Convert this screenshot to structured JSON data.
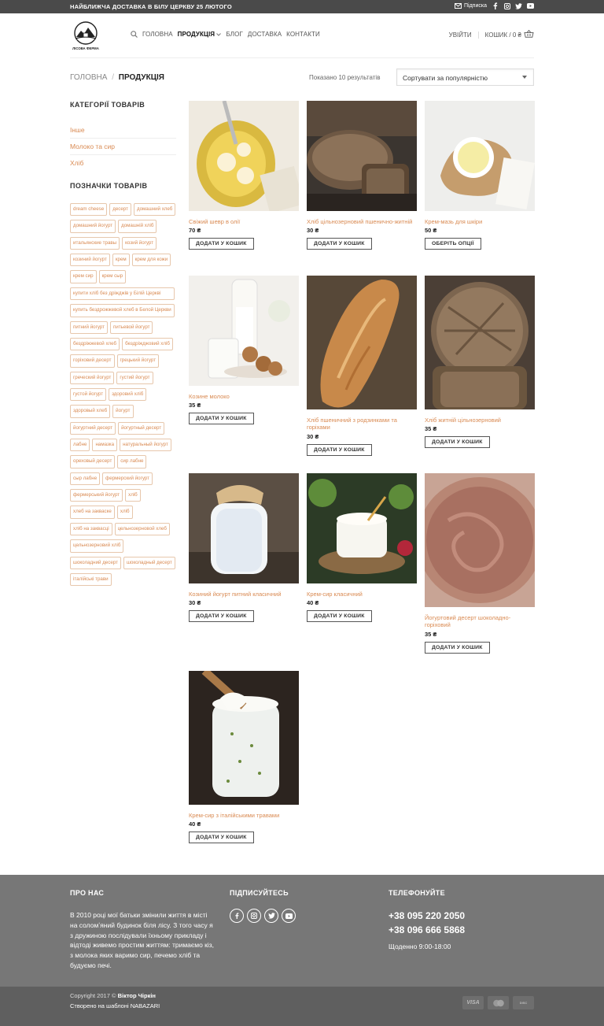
{
  "topbar": {
    "promo": "НАЙБЛИЖЧА ДОСТАВКА В БІЛУ ЦЕРКВУ 25 ЛЮТОГО",
    "subscribe": "Підписка"
  },
  "header": {
    "logo_text": "ЛІСОВА ФЕРМА",
    "nav": [
      {
        "label": "ГОЛОВНА"
      },
      {
        "label": "ПРОДУКЦІЯ"
      },
      {
        "label": "БЛОГ"
      },
      {
        "label": "ДОСТАВКА"
      },
      {
        "label": "КОНТАКТИ"
      }
    ],
    "login": "УВІЙТИ",
    "cart": "КОШИК / 0 ₴"
  },
  "breadcrumb": {
    "home": "ГОЛОВНА",
    "sep": "/",
    "current": "ПРОДУКЦІЯ"
  },
  "results_text": "Показано 10 результатів",
  "sort": {
    "selected": "Сортувати за популярністю"
  },
  "sidebar": {
    "categories_title": "КАТЕГОРІЇ ТОВАРІВ",
    "categories": [
      "Інше",
      "Молоко та сир",
      "Хліб"
    ],
    "tags_title": "ПОЗНАЧКИ ТОВАРІВ",
    "tags": [
      "dream cheese",
      "десерт",
      "домашний хлеб",
      "домашний йогурт",
      "домашній хліб",
      "итальянские травы",
      "козий йогурт",
      "козиний йогурт",
      "крем",
      "крем для кожи",
      "крем сир",
      "крем сыр",
      "купити хліб без дріжджів у Білій Церкві",
      "купить бездрожжевой хлеб в Белой Церкви",
      "питний йогурт",
      "питьевой йогурт",
      "бездріжжевой хлеб",
      "бездріжджовий хліб",
      "горіховий десерт",
      "грецький йогурт",
      "греческий йогурт",
      "густий йогурт",
      "густой йогурт",
      "здоровий хліб",
      "здоровый хлеб",
      "йогурт",
      "йогуртний десерт",
      "йогуртный десерт",
      "лабне",
      "намазка",
      "натуральный йогурт",
      "ореховый десерт",
      "сир лабне",
      "сыр лабне",
      "фермерский йогурт",
      "фермерський йогурт",
      "хліб",
      "хлеб на закваске",
      "хліб",
      "хліб на заквасці",
      "цельнозерновой хлеб",
      "цельнозерновий хліб",
      "шоколадний десерт",
      "шоколадный десерт",
      "італійські трави"
    ]
  },
  "products": [
    {
      "name": "Свіжий шевр в олії",
      "price": "70 ₴",
      "button": "ДОДАТИ У КОШИК"
    },
    {
      "name": "Хліб цільнозерновий пшенично-житній",
      "price": "30 ₴",
      "button": "ДОДАТИ У КОШИК"
    },
    {
      "name": "Крем-мазь для шкіри",
      "price": "50 ₴",
      "button": "ОБЕРІТЬ ОПЦІЇ"
    },
    {
      "name": "Козине молоко",
      "price": "35 ₴",
      "button": "ДОДАТИ У КОШИК"
    },
    {
      "name": "Хліб пшеничний з родзинками та горіхами",
      "price": "30 ₴",
      "button": "ДОДАТИ У КОШИК"
    },
    {
      "name": "Хліб житній цільнозерновий",
      "price": "35 ₴",
      "button": "ДОДАТИ У КОШИК"
    },
    {
      "name": "Козиний йогурт питний класичний",
      "price": "30 ₴",
      "button": "ДОДАТИ У КОШИК"
    },
    {
      "name": "Крем-сир класичний",
      "price": "40 ₴",
      "button": "ДОДАТИ У КОШИК"
    },
    {
      "name": "Йогуртовий десерт шоколадно-горіховий",
      "price": "35 ₴",
      "button": "ДОДАТИ У КОШИК"
    },
    {
      "name": "Крем-сир з італійськими травами",
      "price": "40 ₴",
      "button": "ДОДАТИ У КОШИК"
    }
  ],
  "footer": {
    "about_title": "ПРО НАС",
    "about_text": "В 2010 році мої батьки змінили життя в місті на соломʼяний будинок біля лісу. З того часу я з дружиною послідували їхньому прикладу і відтоді живемо простим життям: тримаємо кіз, з молока яких варимо сир, печемо хліб та будуємо печі.",
    "subscribe_title": "ПІДПИСУЙТЕСЬ",
    "phone_title": "ТЕЛЕФОНУЙТЕ",
    "phone1": "+38 095 220 2050",
    "phone2": "+38 096 666 5868",
    "hours": "Щоденно 9:00-18:00",
    "copyright_prefix": "Copyright 2017 ©",
    "copyright_name": "Віктор Чіркін",
    "made_with": "Створено на шаблоні NABAZARI",
    "cards": [
      "VISA",
      "MC",
      "DISC"
    ]
  },
  "icons": {
    "accent": "#d98a52",
    "topbar_bg": "#4a4a4a",
    "footer_bg": "#777777"
  }
}
